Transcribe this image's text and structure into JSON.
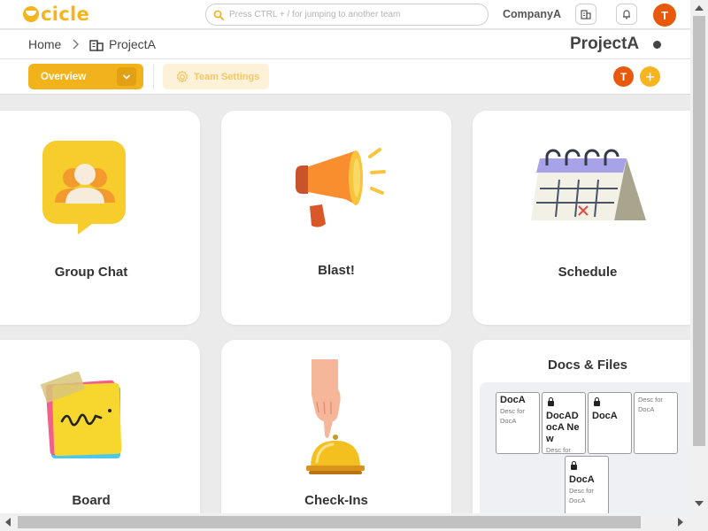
{
  "app": {
    "logo_text": "cicle",
    "brand_color": "#f6b51e"
  },
  "header": {
    "search_placeholder": "Press CTRL + / for jumping to another team",
    "company_name": "CompanyA",
    "user_initial": "T"
  },
  "breadcrumb": {
    "home": "Home",
    "project": "ProjectA"
  },
  "page": {
    "title": "ProjectA"
  },
  "tabs": {
    "overview_label": "Overview",
    "team_settings_label": "Team Settings",
    "member_initial": "T",
    "add_label": "+"
  },
  "cards": {
    "group_chat": "Group Chat",
    "blast": "Blast!",
    "schedule": "Schedule",
    "board": "Board",
    "check_ins": "Check-Ins",
    "docs_files": "Docs & Files"
  },
  "docs": [
    {
      "name": "DocA",
      "desc": "Desc for DocA",
      "locked": false
    },
    {
      "name": "DocADocA New",
      "desc": "Desc for",
      "locked": true
    },
    {
      "name": "DocA",
      "desc": "",
      "locked": true
    },
    {
      "name": "",
      "desc": "Desc for DocA",
      "locked": false
    },
    {
      "name": "DocA",
      "desc": "Desc for DocA",
      "locked": true
    }
  ]
}
